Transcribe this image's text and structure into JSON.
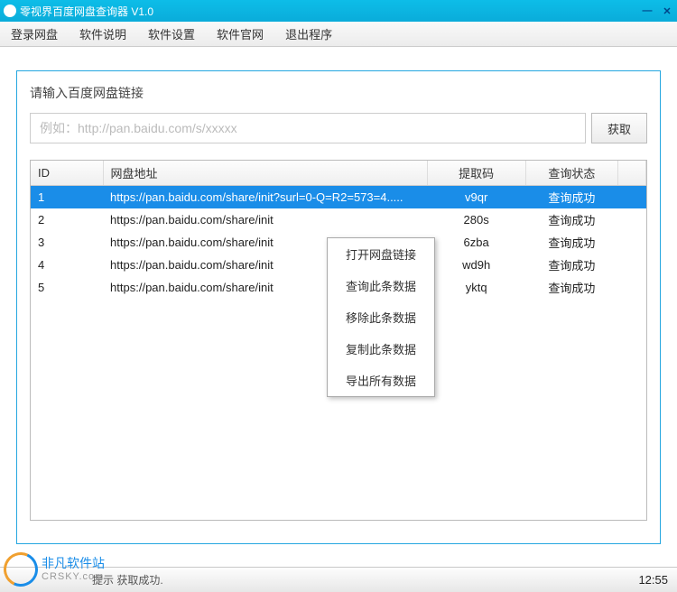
{
  "window": {
    "title": "零视界百度网盘查询器 V1.0"
  },
  "menu": {
    "items": [
      "登录网盘",
      "软件说明",
      "软件设置",
      "软件官网",
      "退出程序"
    ]
  },
  "panel": {
    "prompt": "请输入百度网盘链接",
    "input_placeholder": "例如：http://pan.baidu.com/s/xxxxx",
    "fetch_label": "获取"
  },
  "table": {
    "columns": [
      "ID",
      "网盘地址",
      "提取码",
      "查询状态"
    ],
    "rows": [
      {
        "id": "1",
        "url": "https://pan.baidu.com/share/init?surl=0-Q=R2=573=4.....",
        "code": "v9qr",
        "status": "查询成功",
        "selected": true
      },
      {
        "id": "2",
        "url": "https://pan.baidu.com/share/init",
        "code": "280s",
        "status": "查询成功",
        "selected": false
      },
      {
        "id": "3",
        "url": "https://pan.baidu.com/share/init",
        "code": "6zba",
        "status": "查询成功",
        "selected": false
      },
      {
        "id": "4",
        "url": "https://pan.baidu.com/share/init",
        "code": "wd9h",
        "status": "查询成功",
        "selected": false
      },
      {
        "id": "5",
        "url": "https://pan.baidu.com/share/init",
        "code": "yktq",
        "status": "查询成功",
        "selected": false
      }
    ]
  },
  "context_menu": {
    "items": [
      "打开网盘链接",
      "查询此条数据",
      "移除此条数据",
      "复制此条数据",
      "导出所有数据"
    ]
  },
  "statusbar": {
    "hint_label": "提示",
    "message": "获取成功.",
    "time": "12:55"
  },
  "watermark": {
    "cn": "非凡软件站",
    "en": "CRSKY.com"
  }
}
